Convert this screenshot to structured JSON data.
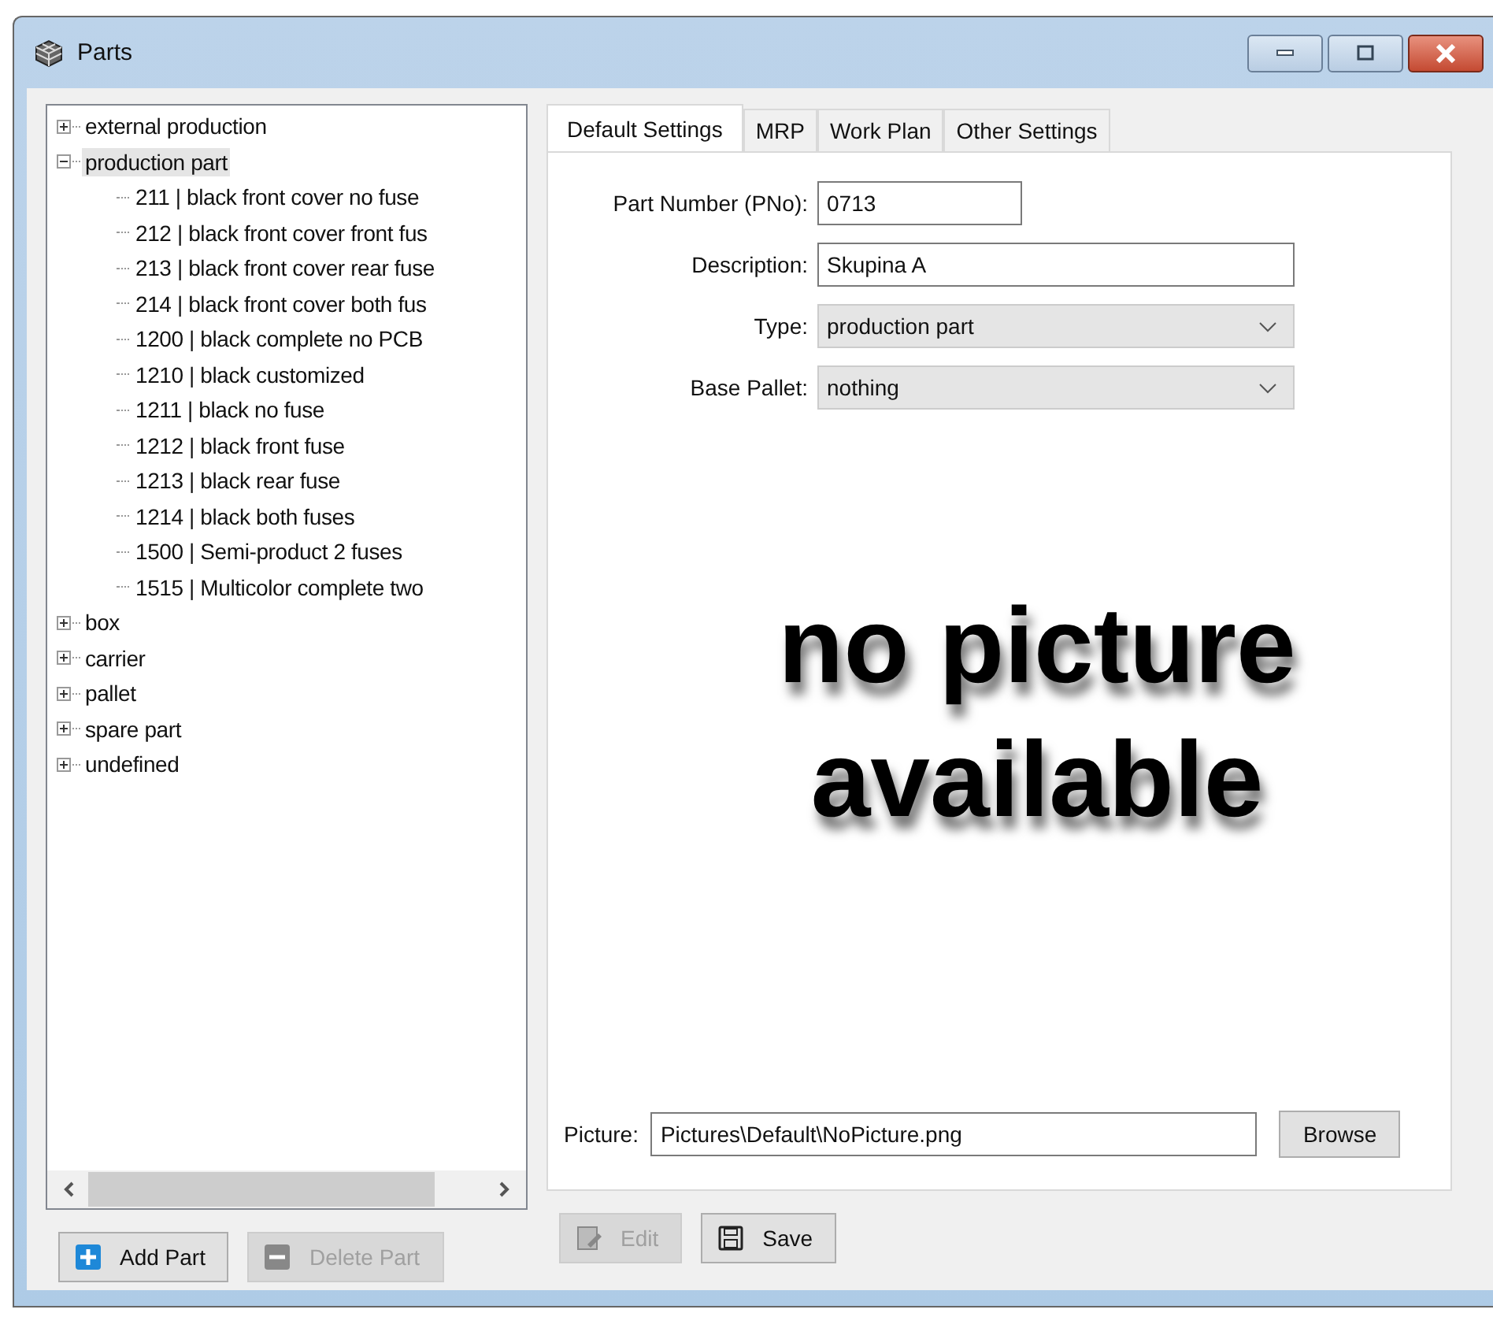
{
  "window": {
    "title": "Parts"
  },
  "tree": [
    {
      "label": "external production",
      "expanded": false,
      "selected": false
    },
    {
      "label": "production part",
      "expanded": true,
      "selected": true,
      "children": [
        {
          "label": "211 | black front cover no fuse"
        },
        {
          "label": "212 | black front cover front fus"
        },
        {
          "label": "213 | black front cover rear fuse"
        },
        {
          "label": "214 | black front cover both fus"
        },
        {
          "label": "1200 | black complete no PCB"
        },
        {
          "label": "1210 | black customized"
        },
        {
          "label": "1211 | black no fuse"
        },
        {
          "label": "1212 | black front fuse"
        },
        {
          "label": "1213 | black rear fuse"
        },
        {
          "label": "1214 | black both fuses"
        },
        {
          "label": "1500 | Semi-product 2 fuses"
        },
        {
          "label": "1515 | Multicolor complete two"
        }
      ]
    },
    {
      "label": "box",
      "expanded": false,
      "selected": false
    },
    {
      "label": "carrier",
      "expanded": false,
      "selected": false
    },
    {
      "label": "pallet",
      "expanded": false,
      "selected": false
    },
    {
      "label": "spare part",
      "expanded": false,
      "selected": false
    },
    {
      "label": "undefined",
      "expanded": false,
      "selected": false
    }
  ],
  "left_buttons": [
    {
      "label": "Add Part",
      "disabled": false,
      "kind": "add"
    },
    {
      "label": "Delete Part",
      "disabled": true,
      "kind": "delete"
    }
  ],
  "tabs": [
    {
      "label": "Default Settings",
      "selected": true
    },
    {
      "label": "MRP",
      "selected": false
    },
    {
      "label": "Work Plan",
      "selected": false
    },
    {
      "label": "Other Settings",
      "selected": false
    }
  ],
  "fields": [
    {
      "label": "Part Number (PNo):",
      "value": "0713",
      "kind": "short_text"
    },
    {
      "label": "Description:",
      "value": "Skupina A",
      "kind": "text"
    },
    {
      "label": "Type:",
      "value": "production part",
      "kind": "dropdown"
    },
    {
      "label": "Base Pallet:",
      "value": "nothing",
      "kind": "dropdown"
    }
  ],
  "no_picture": [
    "no picture",
    "available"
  ],
  "picture": {
    "label": "Picture:",
    "value": "Pictures\\Default\\NoPicture.png",
    "button": "Browse"
  },
  "bottom_buttons": [
    {
      "label": "Edit",
      "disabled": true,
      "kind": "edit"
    },
    {
      "label": "Save",
      "disabled": false,
      "kind": "save"
    }
  ]
}
